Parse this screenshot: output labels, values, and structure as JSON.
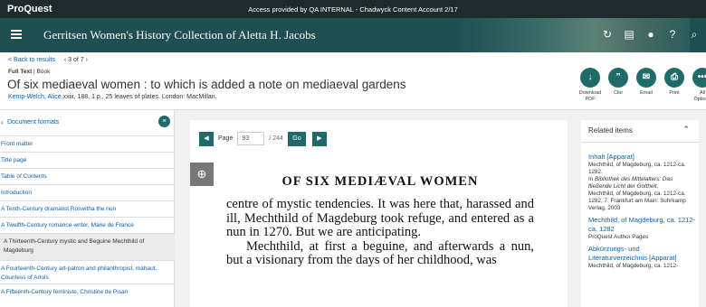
{
  "topbar": {
    "logo": "ProQuest",
    "access": "Access provided by QA INTERNAL - Chadwyck Content Account 2/17"
  },
  "header": {
    "title": "Gerritsen Women's History Collection of Aletta H. Jacobs"
  },
  "breadcrumb": {
    "back": "< Back to results",
    "page": "‹ 3 of 7 ›"
  },
  "meta": {
    "type1": "Full Text",
    "sep": " | ",
    "type2": "Book"
  },
  "document": {
    "title": "Of six mediaeval women : to which is added a note on mediaeval gardens",
    "author": "Kemp-Welch, Alice",
    "details": ".xxix, 188, 1 p., 25 leaves of plates. London: MacMillan."
  },
  "actions": [
    {
      "label": "Download PDF",
      "icon": "download-pdf-icon"
    },
    {
      "label": "Cite",
      "icon": "quote-icon"
    },
    {
      "label": "Email",
      "icon": "email-icon"
    },
    {
      "label": "Print",
      "icon": "print-icon"
    },
    {
      "label": "All Options",
      "icon": "more-icon"
    }
  ],
  "sidebar": {
    "heading": "Document formats",
    "items": [
      "Front matter",
      "Title page",
      "Table of Contents",
      "Introduction",
      "A Tenth-Century dramatist Roswitha the nun",
      "A Twelfth-Century romance-writer, Marie de France",
      "A Thirteenth-Century mystic and Beguine Mechthild of Magdeburg",
      "A Fourteenth-Century art-patron and philanthropist, mahaut, Countess of Artois",
      "A Fifteenth-Century feministe, Christine de Pisan"
    ],
    "selected_index": 6
  },
  "viewer": {
    "page_label": "Page",
    "page_value": "93",
    "total": "/ 244",
    "go": "Go",
    "heading": "OF SIX MEDIÆVAL WOMEN",
    "para1": "centre of mystic tendencies. It was here that, harassed and ill, Mechthild of Magdeburg took refuge, and entered as a nun in 1270. But we are anticipating.",
    "para2": "Mechthild, at first a beguine, and afterwards a nun, but a visionary from the days of her childhood, was"
  },
  "related": {
    "heading": "Related items",
    "items": [
      {
        "title": "Inhalt [Apparat]",
        "line1": "Mechthild, of Magdeburg, ca. 1212-ca. 1282.",
        "line2_prefix": "In ",
        "line2_italic": "Bibliothek des Mittelalters: Das fließende Licht der Gottheit,",
        "line3": "Mechthild, of Magdeburg, ca. 1212-ca. 1282, 7. Frankfurt am Main: Suhrkamp Verlag, 2003"
      },
      {
        "title": "Mechthild, of Magdeburg, ca. 1212-ca. 1282",
        "line1": "ProQuest Author Pages"
      },
      {
        "title": "Abkürzungs- und Literaturverzeichnis [Apparat]",
        "line1": "Mechthild, of Magdeburg, ca. 1212-"
      }
    ]
  },
  "colors": {
    "accent": "#1f6b6a",
    "header": "#1f4f52",
    "link": "#0a5fae"
  }
}
